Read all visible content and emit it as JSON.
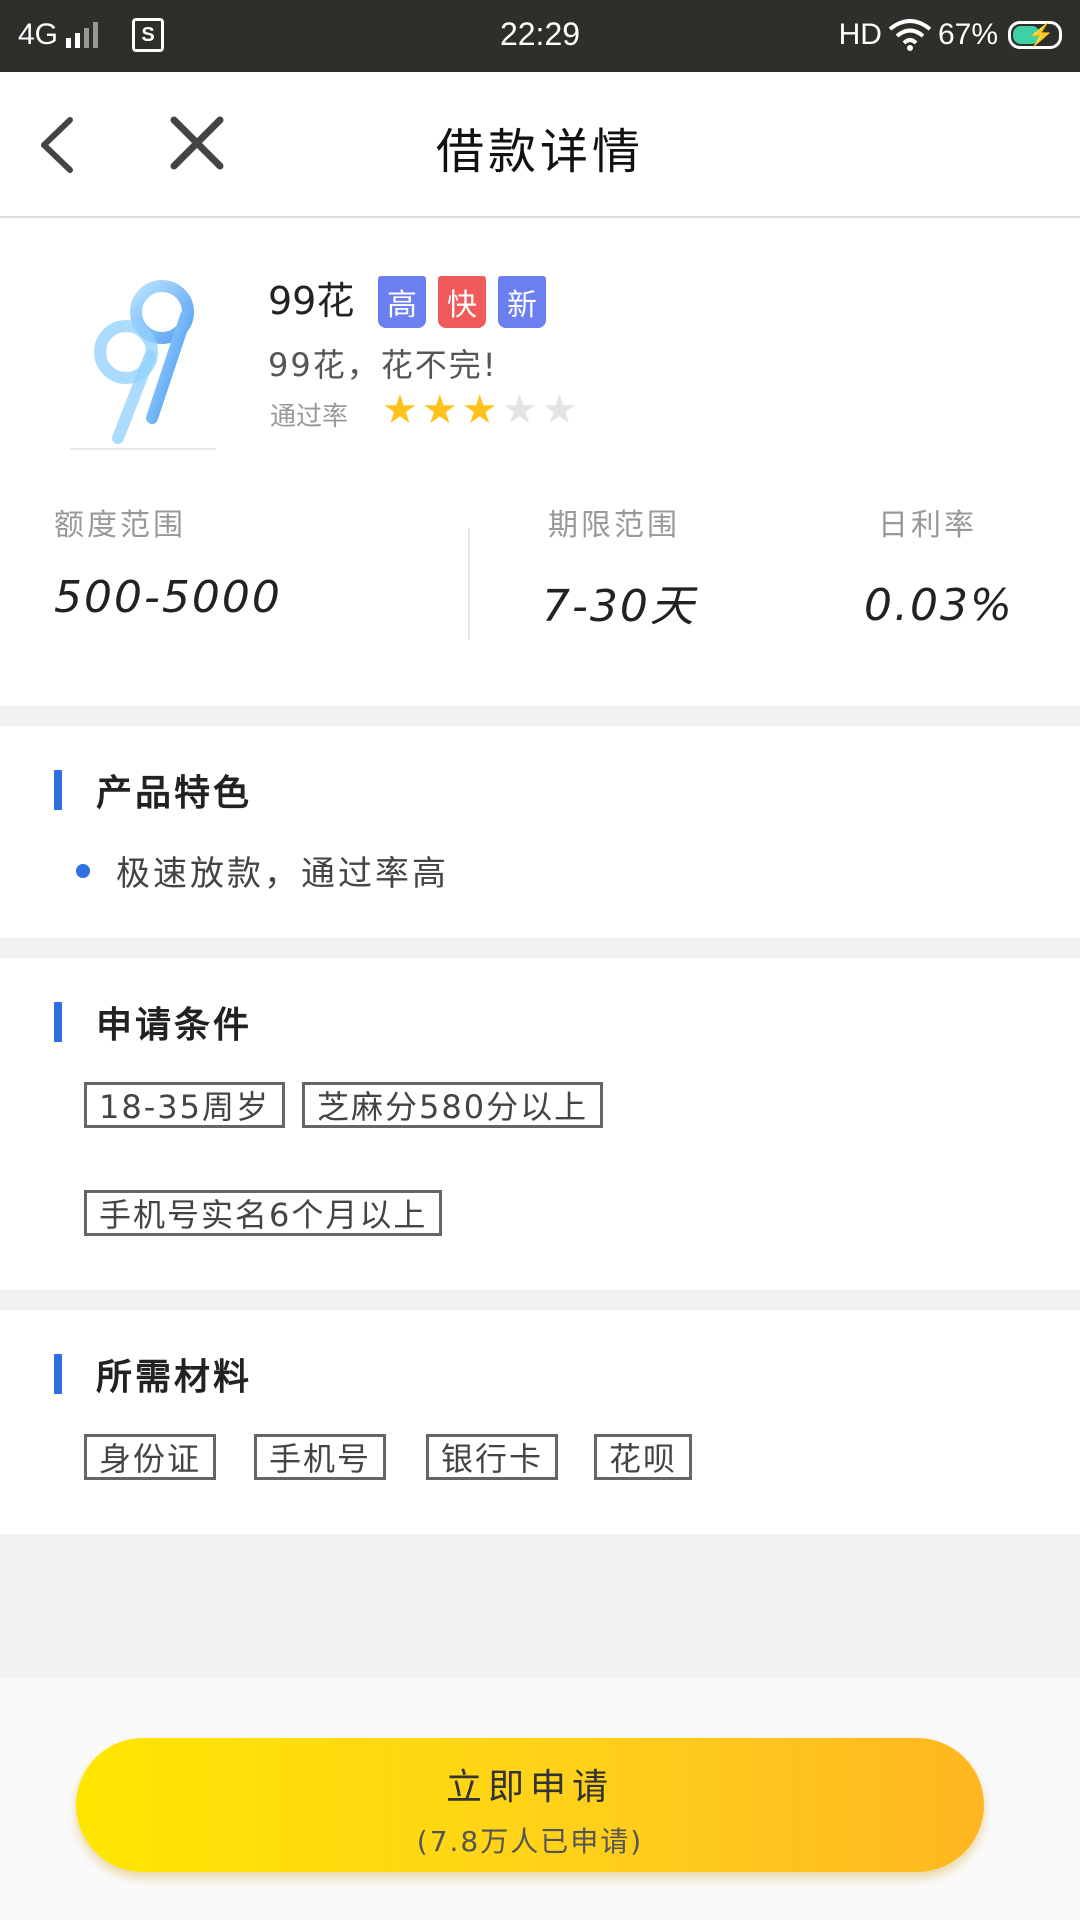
{
  "status_bar": {
    "network": "4G",
    "time": "22:29",
    "hd": "HD",
    "battery": "67%",
    "battery_level": 0.67,
    "app_icon": "S"
  },
  "nav": {
    "title": "借款详情",
    "back_icon": "back-arrow-icon",
    "close_icon": "close-icon"
  },
  "product": {
    "name": "99花",
    "badges": [
      {
        "label": "高",
        "color": "#6b7ff0"
      },
      {
        "label": "快",
        "color": "#f05a5a"
      },
      {
        "label": "新",
        "color": "#6b7ff0"
      }
    ],
    "slogan": "99花，花不完!",
    "pass_rate_label": "通过率",
    "rating": 3,
    "rating_max": 5,
    "stats": [
      {
        "label": "额度范围",
        "value": "500-5000"
      },
      {
        "label": "期限范围",
        "value": "7-30天"
      },
      {
        "label": "日利率",
        "value": "0.03%"
      }
    ]
  },
  "features": {
    "title": "产品特色",
    "items": [
      "极速放款，通过率高"
    ]
  },
  "conditions": {
    "title": "申请条件",
    "tags": [
      "18-35周岁",
      "芝麻分580分以上",
      "手机号实名6个月以上"
    ]
  },
  "materials": {
    "title": "所需材料",
    "tags": [
      "身份证",
      "手机号",
      "银行卡",
      "花呗"
    ]
  },
  "apply": {
    "label": "立即申请",
    "sub": "(7.8万人已申请)"
  },
  "colors": {
    "accent": "#2f6fe0",
    "star_on": "#ffc21a",
    "star_off": "#e4e4e4",
    "button": "#ffd11a"
  }
}
